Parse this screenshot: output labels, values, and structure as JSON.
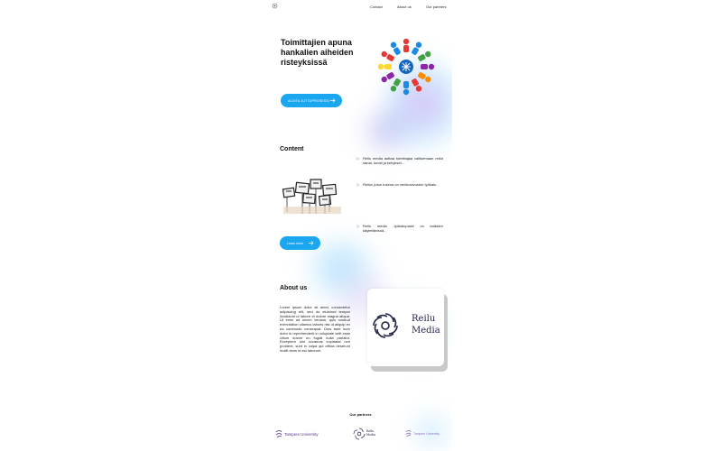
{
  "nav": {
    "links": [
      "Contact",
      "About us",
      "Our partners"
    ]
  },
  "hero": {
    "title": "Toimittajien apuna hankalien aiheiden risteyksissä",
    "button_label": "ALOITA JUTTUPROSESSI"
  },
  "content": {
    "title": "Content",
    "bullets": [
      "Reilu media auttaa toimittajaa valitsemaan reilut sanat, kuvat ja kehykset...",
      "Reilun jutun tukena on verkkosivuston työkalu...",
      "Reilu media -työkalupakki on kaikkien käytettävissä..."
    ],
    "learn_more_label": "Learn more"
  },
  "about": {
    "title": "About us",
    "text": "Lorem ipsum dolor sit amet, consectetur adipiscing elit, sed do eiusmod tempor incididunt ut labore et dolore magna aliqua. Ut enim ad minim veniam, quis nostrud exercitation ullamco laboris nisi ut aliquip ex ea commodo consequat. Duis aute irure dolor in reprehenderit in voluptate velit esse cillum dolore eu fugiat nulla pariatur. Excepteur sint occaecat cupidatat non proident, sunt in culpa qui officia deserunt mollit anim id est laborum.",
    "logo_line1": "Reilu",
    "logo_line2": "Media"
  },
  "partners": {
    "title": "Our partners",
    "items": [
      {
        "name_a": "Tampere University"
      },
      {
        "name_b1": "Reilu",
        "name_b2": "Media"
      },
      {
        "name_c": "Tampere University"
      }
    ]
  },
  "colors": {
    "accent": "#1ba7f0",
    "brand_navy": "#22254a",
    "tu_purple": "#5a2e8c"
  }
}
